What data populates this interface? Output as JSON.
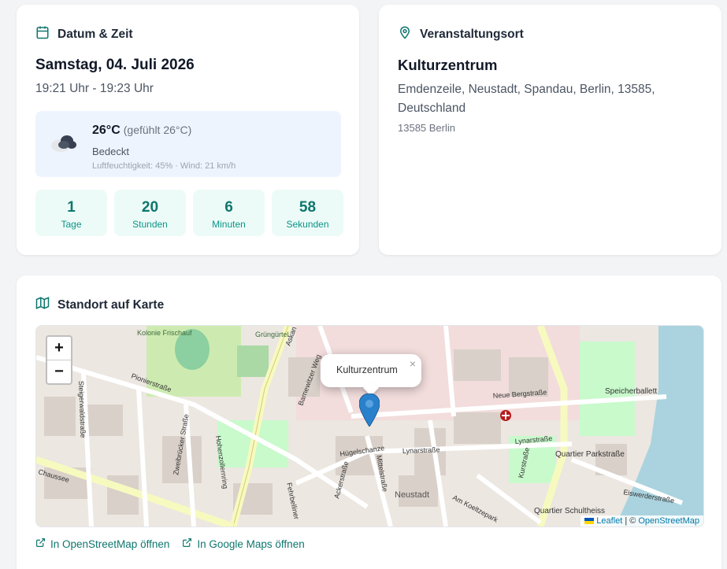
{
  "date_card": {
    "title": "Datum & Zeit",
    "date": "Samstag, 04. Juli 2026",
    "time_range": "19:21 Uhr - 19:23 Uhr",
    "weather": {
      "temperature": "26°C",
      "feels_like": "(gefühlt 26°C)",
      "condition": "Bedeckt",
      "details": "Luftfeuchtigkeit: 45% · Wind: 21 km/h",
      "icon": "cloudy-icon"
    },
    "countdown": [
      {
        "value": "1",
        "label": "Tage"
      },
      {
        "value": "20",
        "label": "Stunden"
      },
      {
        "value": "6",
        "label": "Minuten"
      },
      {
        "value": "58",
        "label": "Sekunden"
      }
    ]
  },
  "venue_card": {
    "title": "Veranstaltungsort",
    "name": "Kulturzentrum",
    "address": "Emdenzeile, Neustadt, Spandau, Berlin, 13585, Deutschland",
    "city": "13585 Berlin"
  },
  "map_card": {
    "title": "Standort auf Karte",
    "zoom_in": "+",
    "zoom_out": "−",
    "popup_text": "Kulturzentrum",
    "popup_close": "×",
    "attribution_leaflet": "Leaflet",
    "attribution_sep": "| ©",
    "attribution_osm": "OpenStreetMap",
    "links": {
      "osm": "In OpenStreetMap öffnen",
      "google": "In Google Maps öffnen"
    },
    "map_labels": {
      "pionierstrasse": "Pionierstraße",
      "neue_bergstrasse": "Neue Bergstraße",
      "lynarstrasse": "Lynarstraße",
      "neustadt": "Neustadt",
      "quartier_parkstrasse": "Quartier Parkstraße",
      "speicherballett": "Speicherballett",
      "kolonie_frischauf": "Kolonie Frischauf",
      "gruengurtel": "Grüngürtel",
      "askanierring": "Askan",
      "chaussee": "Chaussee",
      "eiswerderstrasse": "Eiswerderstraße",
      "am_koeltzepark": "Am Koeltzepark",
      "huegelschanze": "Hügelschanze",
      "quartier_schultheiss": "Quartier Schultheiss",
      "mittelstrasse": "Mittelstraße",
      "kurstrasse": "Kurstraße",
      "ackerstrasse": "Ackerstraße",
      "barnewitzer_weg": "Barnewitzer Weg",
      "zweibruecker_strasse": "Zweibrücker Straße",
      "hohenzollernring": "Hohenzollernring",
      "steigerwaldstrasse": "Steigerwaldstraße",
      "fehrbelliner": "Fehrbelliner"
    }
  },
  "colors": {
    "accent": "#0f766e",
    "countdown_bg": "#ecfbf7",
    "weather_bg": "#eef4fd",
    "water": "#aad3df",
    "park": "#c8facc"
  }
}
